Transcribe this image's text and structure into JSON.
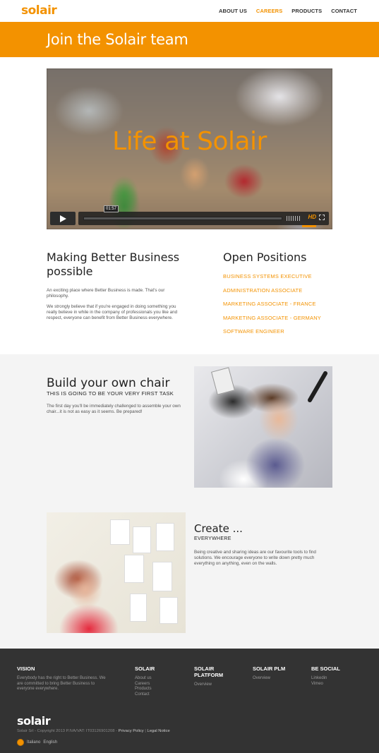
{
  "header": {
    "logo": "solair",
    "nav": [
      {
        "label": "ABOUT US",
        "active": false
      },
      {
        "label": "CAREERS",
        "active": true
      },
      {
        "label": "PRODUCTS",
        "active": false
      },
      {
        "label": "CONTACT",
        "active": false
      }
    ]
  },
  "banner": {
    "title": "Join the Solair team"
  },
  "video": {
    "title": "Life at Solair",
    "time": "01:57",
    "hd_label": "HD",
    "progress": 0
  },
  "intro": {
    "title": "Making Better Business possible",
    "p1": "An exciting place where Better Business is made. That's our philosophy.",
    "p2": "We strongly believe that if you're engaged in doing something you really believe in while in the company of professionals you like and respect, everyone can benefit from Better Business everywhere."
  },
  "positions": {
    "title": "Open Positions",
    "items": [
      "BUSINESS SYSTEMS EXECUTIVE",
      "ADMINISTRATION ASSOCIATE",
      "MARKETING ASSOCIATE - FRANCE",
      "MARKETING ASSOCIATE - GERMANY",
      "SOFTWARE ENGINEER"
    ]
  },
  "chair": {
    "title": "Build your own chair",
    "subtitle": "THIS IS GOING TO BE YOUR VERY FIRST TASK",
    "text": "The first day you'll be immediately challenged to assemble your own chair...it is not as easy as it seems. Be prepared!"
  },
  "create": {
    "title": "Create ...",
    "subtitle": "EVERYWHERE",
    "text": "Being creative and sharing ideas are our favourite tools to find solutions. We encourage everyone to write down pretty much everything on anything, even on the walls."
  },
  "footer": {
    "vision": {
      "title": "VISION",
      "text": "Everybody has the right to Better Business. We are committed to bring Better Business to everyone everywhere."
    },
    "solair": {
      "title": "SOLAIR",
      "links": [
        "About us",
        "Careers",
        "Products",
        "Contact"
      ]
    },
    "platform": {
      "title": "SOLAIR PLATFORM",
      "links": [
        "Overview"
      ]
    },
    "plm": {
      "title": "SOLAIR PLM",
      "links": [
        "Overview"
      ]
    },
    "social": {
      "title": "BE SOCIAL",
      "links": [
        "Linkedin",
        "Vimeo"
      ]
    },
    "logo": "solair",
    "copyright": "Solair Srl - Copyright 2013 P.IVA/VAT: IT03126901208 -",
    "privacy": "Privacy Policy",
    "legal": "Legal Notice",
    "separator": "|",
    "lang_it": "Italiano",
    "lang_en": "English"
  },
  "colors": {
    "accent": "#f39200",
    "footer_bg": "#333333",
    "section_bg": "#f4f4f4"
  }
}
